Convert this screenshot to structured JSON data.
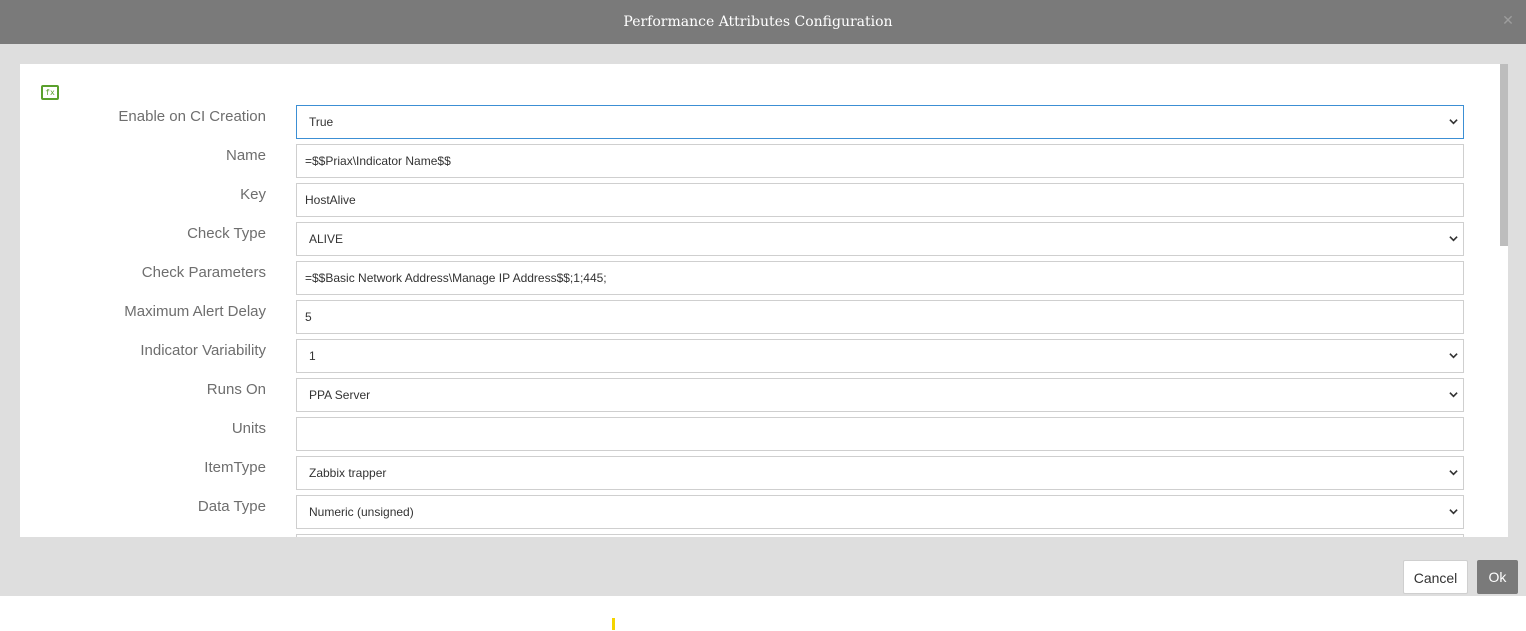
{
  "dialog": {
    "title": "Performance Attributes Configuration",
    "close_icon": "close-icon",
    "formula_icon": "fx",
    "cancel_label": "Cancel",
    "ok_label": "Ok"
  },
  "fields": [
    {
      "label": "Enable on CI Creation",
      "value": "True",
      "type": "select"
    },
    {
      "label": "Name",
      "value": "=$$Priax\\Indicator Name$$",
      "type": "text"
    },
    {
      "label": "Key",
      "value": "HostAlive",
      "type": "text"
    },
    {
      "label": "Check Type",
      "value": "ALIVE",
      "type": "select"
    },
    {
      "label": "Check Parameters",
      "value": "=$$Basic Network Address\\Manage IP Address$$;1;445;",
      "type": "text"
    },
    {
      "label": "Maximum Alert Delay",
      "value": "5",
      "type": "text"
    },
    {
      "label": "Indicator Variability",
      "value": "1",
      "type": "select"
    },
    {
      "label": "Runs On",
      "value": "PPA Server",
      "type": "select"
    },
    {
      "label": "Units",
      "value": "",
      "type": "text"
    },
    {
      "label": "ItemType",
      "value": "Zabbix trapper",
      "type": "select"
    },
    {
      "label": "Data Type",
      "value": "Numeric (unsigned)",
      "type": "select"
    }
  ],
  "colors": {
    "header": "#7a7a7a",
    "focus": "#3c8fd4",
    "accent_green": "#5aa02c"
  }
}
